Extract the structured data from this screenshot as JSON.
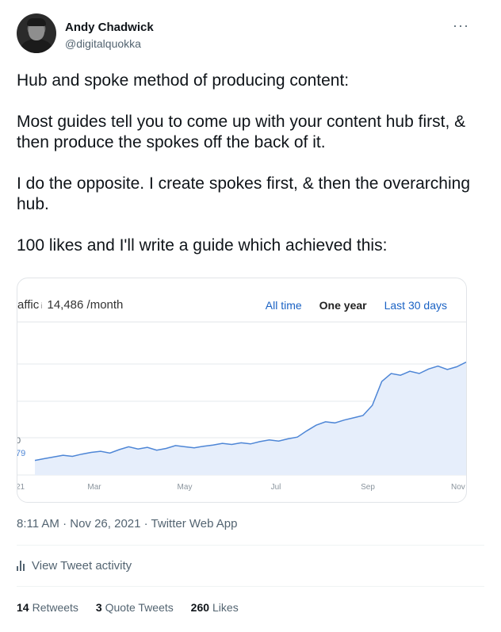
{
  "author": {
    "name": "Andy Chadwick",
    "handle": "@digitalquokka"
  },
  "more_icon": "···",
  "tweet_text": "Hub and spoke method of producing content:\n\nMost guides tell you to come up with your content hub first, & then produce the spokes off the back of it.\n\nI do the opposite. I create spokes first, & then the overarching hub.\n\n100 likes and I'll write a guide which achieved this:",
  "card": {
    "traffic_label": "affic",
    "info_icon": "i",
    "traffic_value": "14,486 /month",
    "tabs": {
      "all_time": "All time",
      "one_year": "One year",
      "last_30": "Last 30 days"
    },
    "y_tick_top": "0",
    "y_tick_low": "79",
    "x_ticks": [
      "21",
      "Mar",
      "May",
      "Jul",
      "Sep",
      "Nov"
    ]
  },
  "chart_data": {
    "type": "area",
    "x_tick_labels": [
      "21",
      "Mar",
      "May",
      "Jul",
      "Sep",
      "Nov"
    ],
    "note": "traffic trend over one year",
    "values": [
      79,
      82,
      85,
      88,
      86,
      90,
      93,
      95,
      92,
      98,
      103,
      99,
      102,
      97,
      100,
      105,
      103,
      101,
      104,
      106,
      109,
      107,
      110,
      108,
      112,
      115,
      113,
      117,
      120,
      131,
      141,
      147,
      145,
      150,
      154,
      158,
      176,
      218,
      232,
      229,
      236,
      232,
      240,
      245,
      239,
      244,
      252
    ]
  },
  "colors": {
    "line": "#4e86d6",
    "fill": "#e6eefb",
    "grid": "#e6e9ec",
    "link": "#1a62c4"
  },
  "meta": "8:11 AM · Nov 26, 2021 · Twitter Web App",
  "activity_label": "View Tweet activity",
  "stats": [
    {
      "count": "14",
      "label": "Retweets"
    },
    {
      "count": "3",
      "label": "Quote Tweets"
    },
    {
      "count": "260",
      "label": "Likes"
    }
  ]
}
